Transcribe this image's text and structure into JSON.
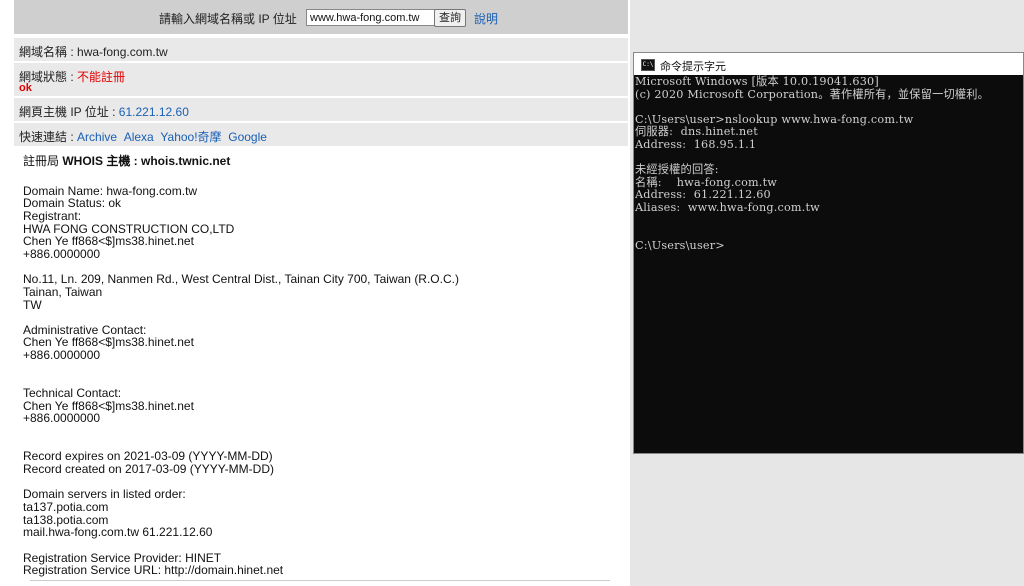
{
  "search": {
    "label": "請輸入網域名稱或 IP 位址",
    "value": "www.hwa-fong.com.tw",
    "button_label": "查詢",
    "help_label": "說明"
  },
  "info": {
    "domain_label": "網域名稱 : ",
    "domain_value": "hwa-fong.com.tw",
    "status_label": "網域狀態 : ",
    "status_value": "不能註冊",
    "status_ok": "ok",
    "ip_label": "網頁主機 IP 位址 : ",
    "ip_value": "61.221.12.60",
    "quick_label": "快速連結 : ",
    "quick_links": [
      "Archive",
      "Alexa",
      "Yahoo!奇摩",
      "Google"
    ]
  },
  "whois": {
    "head_label": "註冊局 ",
    "head_bold": "WHOIS 主機 : whois.twnic.net",
    "text": "Domain Name: hwa-fong.com.tw\nDomain Status: ok\nRegistrant:\nHWA FONG CONSTRUCTION CO,LTD\nChen Ye ff868<$]ms38.hinet.net\n+886.0000000\n\nNo.11, Ln. 209, Nanmen Rd., West Central Dist., Tainan City 700, Taiwan (R.O.C.)\nTainan, Taiwan\nTW\n\nAdministrative Contact:\nChen Ye ff868<$]ms38.hinet.net\n+886.0000000\n\n\nTechnical Contact:\nChen Ye ff868<$]ms38.hinet.net\n+886.0000000\n\n\nRecord expires on 2021-03-09 (YYYY-MM-DD)\nRecord created on 2017-03-09 (YYYY-MM-DD)\n\nDomain servers in listed order:\nta137.potia.com\nta138.potia.com\nmail.hwa-fong.com.tw 61.221.12.60\n\nRegistration Service Provider: HINET\nRegistration Service URL: http://domain.hinet.net"
  },
  "cmd": {
    "icon_text": "C:\\",
    "title": "命令提示字元",
    "output": "Microsoft Windows [版本 10.0.19041.630]\n(c) 2020 Microsoft Corporation。著作權所有，並保留一切權利。\n\nC:\\Users\\user>nslookup www.hwa-fong.com.tw\n伺服器:  dns.hinet.net\nAddress:  168.95.1.1\n\n未經授權的回答:\n名稱:    hwa-fong.com.tw\nAddress:  61.221.12.60\nAliases:  www.hwa-fong.com.tw\n\n\nC:\\Users\\user>"
  }
}
